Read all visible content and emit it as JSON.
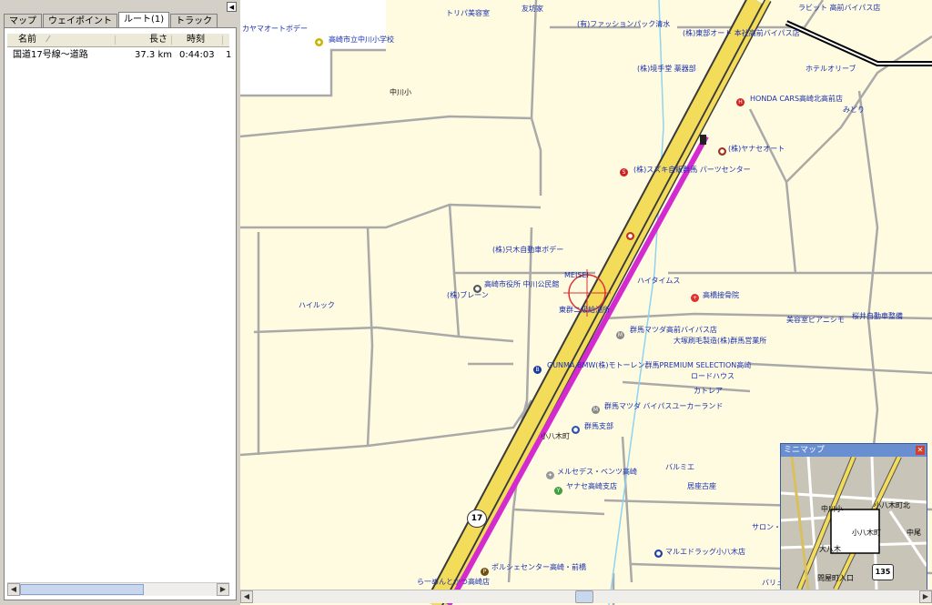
{
  "left_panel": {
    "tabs": [
      {
        "label": "マップ"
      },
      {
        "label": "ウェイポイント"
      },
      {
        "label": "ルート(1)"
      },
      {
        "label": "トラック"
      }
    ],
    "columns": {
      "name": "名前",
      "length": "長さ",
      "time": "時刻"
    },
    "route": {
      "name": "国道17号線〜道路",
      "length": "37.3 km",
      "time": "0:44:03",
      "extra": "1"
    },
    "scroll_left": "◀",
    "scroll_right": "▶",
    "collapse": "◀"
  },
  "map": {
    "labels": [
      {
        "text": "トリパ美容室"
      },
      {
        "text": "友坊家"
      },
      {
        "text": "ラビット 高前バイパス店"
      },
      {
        "text": "カヤマオートボデー"
      },
      {
        "text": "高崎市立中川小学校"
      },
      {
        "text": "(有)ファッションパック清水"
      },
      {
        "text": "(株)東部オート 本社高前バイパス店"
      },
      {
        "text": "ホテルオリーブ"
      },
      {
        "text": "中川小"
      },
      {
        "text": "(株)境手堂 薬器部"
      },
      {
        "text": "HONDA CARS高崎北高前店"
      },
      {
        "text": "みどり"
      },
      {
        "text": "(株)ヤナセオート"
      },
      {
        "text": "(株)スズキ自販群馬 パーツセンター"
      },
      {
        "text": "(株)只木自動車ボデー"
      },
      {
        "text": "MEISEI"
      },
      {
        "text": "ハイタイムス"
      },
      {
        "text": "高崎市役所 中川公民館"
      },
      {
        "text": "(株)ブレーン"
      },
      {
        "text": "高橋接骨院"
      },
      {
        "text": "ハイルック"
      },
      {
        "text": "東群ニ級給油所"
      },
      {
        "text": "美容室ピアニシモ"
      },
      {
        "text": "桜井自動車整備"
      },
      {
        "text": "群馬マツダ高前バイパス店"
      },
      {
        "text": "大塚刷毛製造(株)群馬営業所"
      },
      {
        "text": "GUNMA BMW(株)モトーレン群馬PREMIUM SELECTION高崎"
      },
      {
        "text": "ロードハウス"
      },
      {
        "text": "カトレア"
      },
      {
        "text": "群馬マツダ バイパスユーカーランド"
      },
      {
        "text": "群馬支部"
      },
      {
        "text": "小八木町"
      },
      {
        "text": "バルミエ"
      },
      {
        "text": "メルセデス・ベンツ高崎"
      },
      {
        "text": "ヤナセ高崎支店"
      },
      {
        "text": "居座古座"
      },
      {
        "text": "サロン・ド"
      },
      {
        "text": "マルエドラッグ小八木店"
      },
      {
        "text": "ポルシェセンター高崎・前橋"
      },
      {
        "text": "ら一めんとかつ高崎店"
      },
      {
        "text": "バリュ"
      }
    ],
    "route_shield": "17"
  },
  "minimap": {
    "title": "ミニマップ",
    "close": "✕",
    "labels": [
      {
        "text": "中川小"
      },
      {
        "text": "小八木町北"
      },
      {
        "text": "小八木町"
      },
      {
        "text": "中尾"
      },
      {
        "text": "大八木"
      },
      {
        "text": "問屋町入口"
      }
    ],
    "shield": "135"
  },
  "colors": {
    "map_bg": "#fffbe0",
    "minor_road": "#a9a9a9",
    "highway": "#f2dc5a",
    "route_line": "#d42bd0",
    "panel_bg": "#d4d0c8"
  }
}
